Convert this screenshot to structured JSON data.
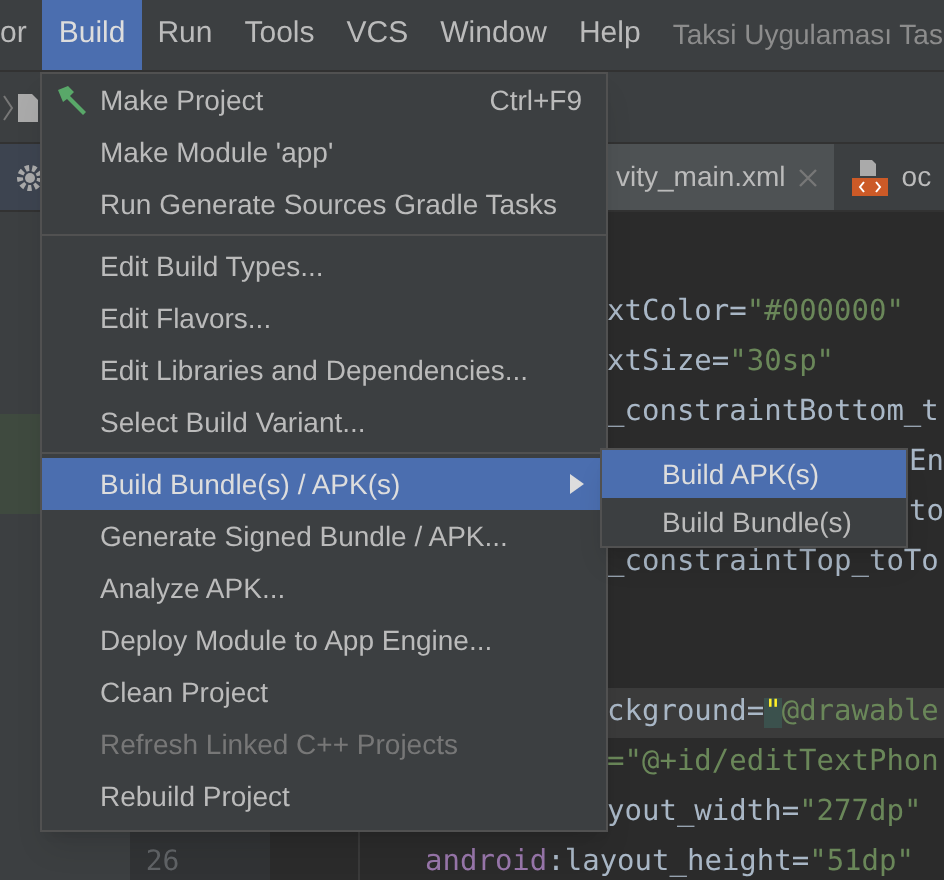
{
  "menu_bar": {
    "items": [
      {
        "label": "or",
        "selected": false
      },
      {
        "label": "Build",
        "selected": true
      },
      {
        "label": "Run",
        "selected": false
      },
      {
        "label": "Tools",
        "selected": false
      },
      {
        "label": "VCS",
        "selected": false
      },
      {
        "label": "Window",
        "selected": false
      },
      {
        "label": "Help",
        "selected": false
      }
    ],
    "title": "Taksi Uygulaması Tas"
  },
  "editor_tabs": [
    {
      "label": "vity_main.xml",
      "selected": true,
      "kind": "text"
    },
    {
      "label": "oc",
      "selected": false,
      "kind": "xml"
    }
  ],
  "editor": {
    "line_number": "26",
    "lines": [
      {
        "kind": "under_menu",
        "current": false,
        "tokens": [
          {
            "kind": "plain",
            "text": "xtColor"
          },
          {
            "kind": "plain",
            "text": "="
          },
          {
            "kind": "string",
            "text": "\"#000000\""
          }
        ]
      },
      {
        "kind": "under_menu",
        "current": false,
        "tokens": [
          {
            "kind": "plain",
            "text": "xtSize"
          },
          {
            "kind": "plain",
            "text": "="
          },
          {
            "kind": "string",
            "text": "\"30sp\""
          }
        ]
      },
      {
        "kind": "under_menu",
        "current": false,
        "tokens": [
          {
            "kind": "plain",
            "text": "_constraintBottom_t"
          }
        ]
      },
      {
        "kind": "under_submenu",
        "current": false,
        "tokens": [
          {
            "kind": "plain",
            "text": "En"
          }
        ]
      },
      {
        "kind": "under_submenu",
        "current": false,
        "tokens": [
          {
            "kind": "plain",
            "text": "to"
          }
        ]
      },
      {
        "kind": "under_menu",
        "current": false,
        "tokens": [
          {
            "kind": "plain",
            "text": "_constraintTop_toTo"
          }
        ]
      },
      {
        "kind": "under_menu",
        "current": false
      },
      {
        "kind": "under_menu",
        "current": false
      },
      {
        "kind": "under_menu",
        "current": true,
        "tokens": [
          {
            "kind": "plain",
            "text": "ckground"
          },
          {
            "kind": "plain",
            "text": "="
          },
          {
            "kind": "match",
            "text": "\""
          },
          {
            "kind": "string",
            "text": "@drawable"
          }
        ]
      },
      {
        "kind": "under_menu",
        "current": false,
        "tokens": [
          {
            "kind": "string",
            "text": "=\"@+id/editTextPhon"
          }
        ]
      },
      {
        "kind": "under_menu",
        "current": false,
        "tokens": [
          {
            "kind": "plain",
            "text": "yout_width"
          },
          {
            "kind": "plain",
            "text": "="
          },
          {
            "kind": "string",
            "text": "\"277dp\""
          }
        ]
      },
      {
        "kind": "full",
        "current": false,
        "tokens": [
          {
            "kind": "ns",
            "text": "android"
          },
          {
            "kind": "plain",
            "text": ":layout_height"
          },
          {
            "kind": "plain",
            "text": "="
          },
          {
            "kind": "string",
            "text": "\"51dp\""
          }
        ]
      }
    ]
  },
  "build_menu": [
    {
      "kind": "item",
      "label": "Make Project",
      "shortcut": "Ctrl+F9",
      "icon": true,
      "disabled": false,
      "selected": false,
      "has_submenu": false
    },
    {
      "kind": "item",
      "label": "Make Module 'app'",
      "disabled": false,
      "selected": false,
      "has_submenu": false
    },
    {
      "kind": "item",
      "label": "Run Generate Sources Gradle Tasks",
      "disabled": false,
      "selected": false,
      "has_submenu": false
    },
    {
      "kind": "separator"
    },
    {
      "kind": "item",
      "label": "Edit Build Types...",
      "disabled": false,
      "selected": false,
      "has_submenu": false
    },
    {
      "kind": "item",
      "label": "Edit Flavors...",
      "disabled": false,
      "selected": false,
      "has_submenu": false
    },
    {
      "kind": "item",
      "label": "Edit Libraries and Dependencies...",
      "disabled": false,
      "selected": false,
      "has_submenu": false
    },
    {
      "kind": "item",
      "label": "Select Build Variant...",
      "disabled": false,
      "selected": false,
      "has_submenu": false
    },
    {
      "kind": "separator"
    },
    {
      "kind": "item",
      "label": "Build Bundle(s) / APK(s)",
      "disabled": false,
      "selected": true,
      "has_submenu": true
    },
    {
      "kind": "item",
      "label": "Generate Signed Bundle / APK...",
      "disabled": false,
      "selected": false,
      "has_submenu": false
    },
    {
      "kind": "item",
      "label": "Analyze APK...",
      "disabled": false,
      "selected": false,
      "has_submenu": false
    },
    {
      "kind": "item",
      "label": "Deploy Module to App Engine...",
      "disabled": false,
      "selected": false,
      "has_submenu": false
    },
    {
      "kind": "item",
      "label": "Clean Project",
      "disabled": false,
      "selected": false,
      "has_submenu": false
    },
    {
      "kind": "item",
      "label": "Refresh Linked C++ Projects",
      "disabled": true,
      "selected": false,
      "has_submenu": false
    },
    {
      "kind": "item",
      "label": "Rebuild Project",
      "disabled": false,
      "selected": false,
      "has_submenu": false
    }
  ],
  "submenu": [
    {
      "label": "Build APK(s)",
      "selected": true
    },
    {
      "label": "Build Bundle(s)",
      "selected": false
    }
  ]
}
